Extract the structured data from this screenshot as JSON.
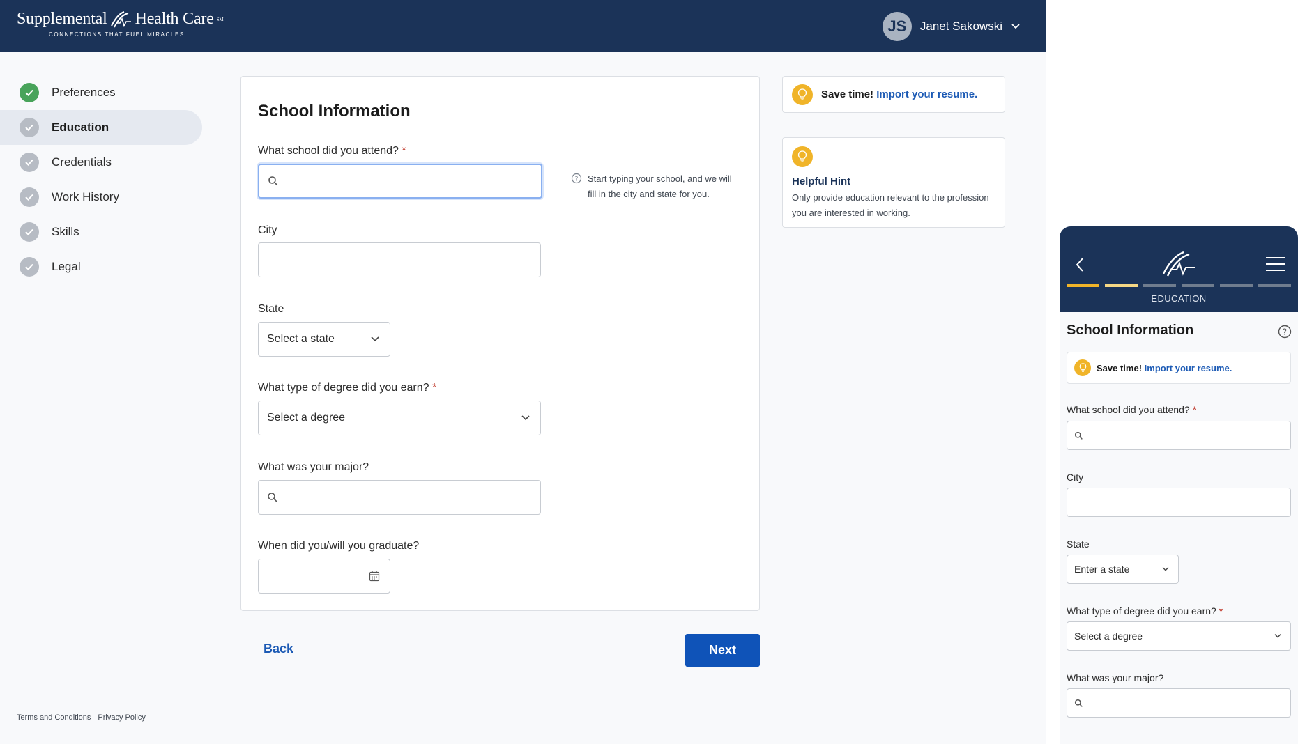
{
  "header": {
    "brand": "Supplemental",
    "brand_tail": "Health Care",
    "tagline": "CONNECTIONS THAT FUEL MIRACLES",
    "user_initials": "JS",
    "user_name": "Janet Sakowski"
  },
  "sidebar": {
    "items": [
      {
        "label": "Preferences",
        "status": "done"
      },
      {
        "label": "Education",
        "status": "active"
      },
      {
        "label": "Credentials",
        "status": "pending"
      },
      {
        "label": "Work History",
        "status": "pending"
      },
      {
        "label": "Skills",
        "status": "pending"
      },
      {
        "label": "Legal",
        "status": "pending"
      }
    ]
  },
  "form": {
    "title": "School Information",
    "school_label": "What school did you attend?",
    "required_mark": "*",
    "school_hint": "Start typing your school, and we will fill in the city and state for you.",
    "city_label": "City",
    "state_label": "State",
    "state_placeholder": "Select a state",
    "degree_label": "What type of degree did you earn?",
    "degree_placeholder": "Select a degree",
    "major_label": "What was your major?",
    "graduate_label": "When did you/will you graduate?",
    "back_label": "Back",
    "next_label": "Next"
  },
  "tips": {
    "save_lead": "Save time!",
    "save_link": "Import your resume.",
    "hint_title": "Helpful Hint",
    "hint_body": "Only provide education relevant to the profession you are interested in working."
  },
  "footer": {
    "terms": "Terms and Conditions",
    "privacy": "Privacy Policy"
  },
  "mobile": {
    "step_label": "EDUCATION",
    "title": "School Information",
    "save_lead": "Save time!",
    "save_link": "Import your resume.",
    "school_label": "What school did you attend?",
    "city_label": "City",
    "state_label": "State",
    "state_placeholder": "Enter a state",
    "degree_label": "What type of degree did you earn?",
    "degree_placeholder": "Select a degree",
    "major_label": "What was your major?",
    "progress_done": 1,
    "progress_partial": 1,
    "progress_total": 6
  },
  "colors": {
    "navy": "#1b3358",
    "primary": "#0f53b8",
    "link": "#1d5bb5",
    "accent": "#f0b429",
    "success": "#48a35a",
    "required": "#c0392b"
  }
}
